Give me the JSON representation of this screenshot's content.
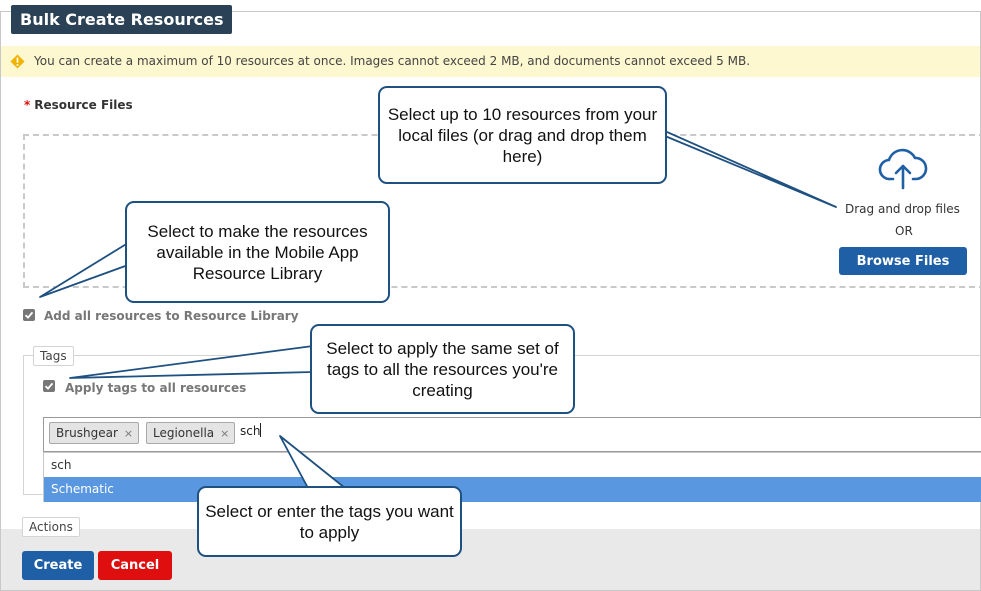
{
  "dialog": {
    "title": "Bulk Create Resources",
    "warning": "You can create a maximum of 10 resources at once. Images cannot exceed 2 MB, and documents cannot exceed 5 MB."
  },
  "resource_files": {
    "required_mark": "*",
    "label": "Resource Files",
    "drag_drop_text": "Drag and drop files",
    "or_text": "OR",
    "browse_label": "Browse Files"
  },
  "resource_library": {
    "checkbox_label": "Add all resources to Resource Library",
    "checked": true
  },
  "tags": {
    "legend": "Tags",
    "apply_all_label": "Apply tags to all resources",
    "apply_all_checked": true,
    "chips": [
      "Brushgear",
      "Legionella"
    ],
    "chip_remove_glyph": "×",
    "typed_value": "sch",
    "suggestions": [
      "sch",
      "Schematic"
    ]
  },
  "actions": {
    "legend": "Actions",
    "create_label": "Create",
    "cancel_label": "Cancel"
  },
  "callouts": {
    "upload": "Select up to 10 resources from your local files (or drag and drop them here)",
    "library": "Select to make the resources available in the Mobile App Resource Library",
    "apply_tags": "Select to apply the same set of tags to all the resources you're creating",
    "select_tags": "Select or enter the tags you want to apply"
  },
  "colors": {
    "title_bg": "#2b4155",
    "primary": "#1f5fa6",
    "danger": "#e00f0f",
    "warning_bg": "#fdf8cf",
    "highlight": "#5a97e1",
    "callout_border": "#1e5080"
  },
  "icons": {
    "warning": "warning-icon",
    "upload": "cloud-upload-icon",
    "checkbox": "checkmark-icon"
  }
}
